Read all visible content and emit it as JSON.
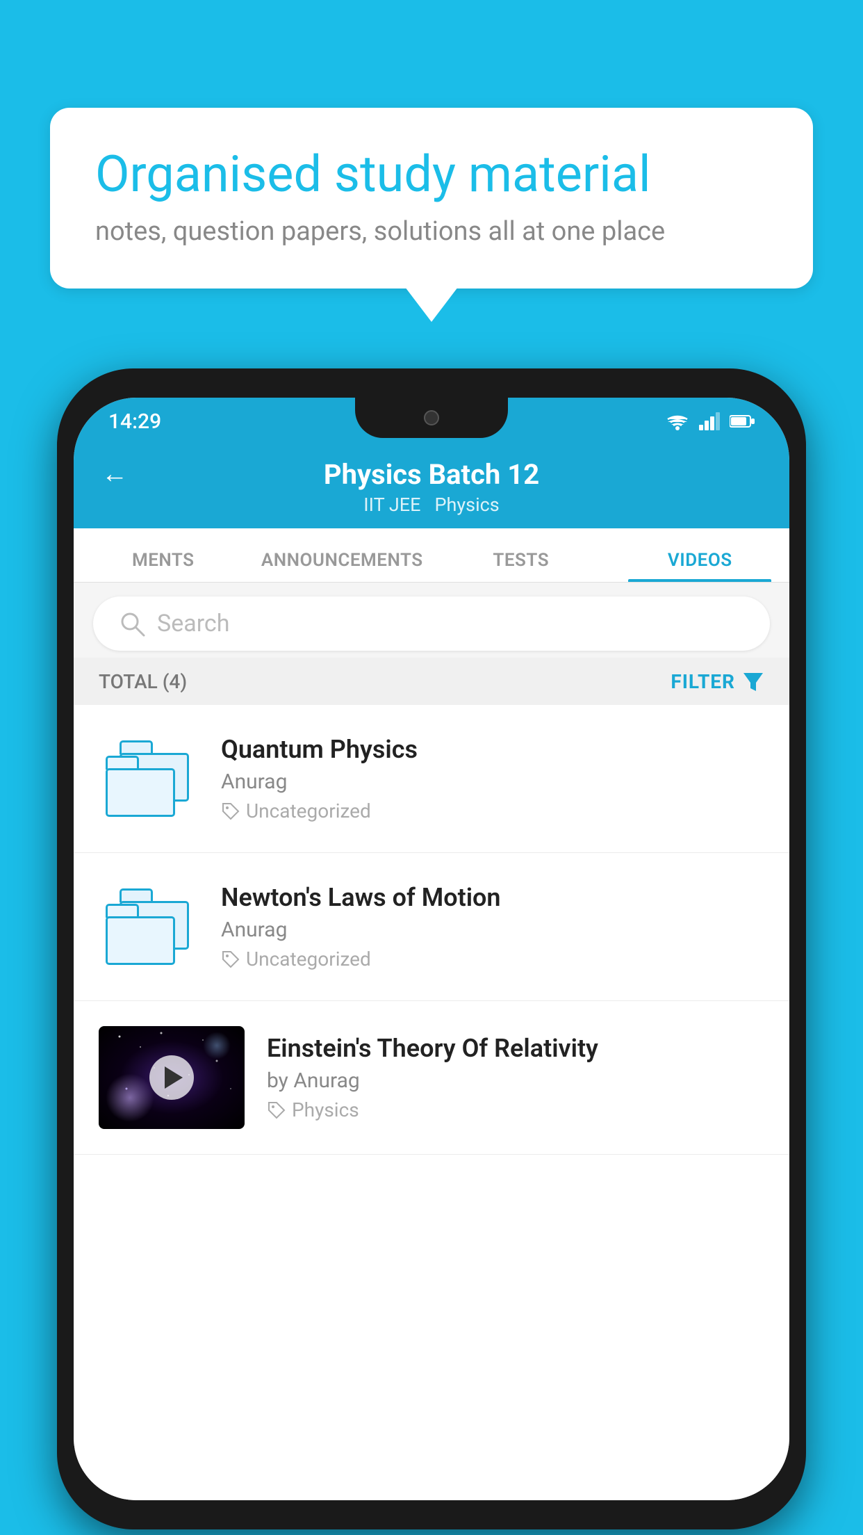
{
  "background_color": "#1bbde8",
  "speech_bubble": {
    "title": "Organised study material",
    "subtitle": "notes, question papers, solutions all at one place"
  },
  "status_bar": {
    "time": "14:29",
    "icons": [
      "wifi",
      "signal",
      "battery"
    ]
  },
  "app_header": {
    "back_label": "←",
    "title": "Physics Batch 12",
    "subtitle_left": "IIT JEE",
    "subtitle_right": "Physics"
  },
  "tabs": [
    {
      "label": "MENTS",
      "active": false
    },
    {
      "label": "ANNOUNCEMENTS",
      "active": false
    },
    {
      "label": "TESTS",
      "active": false
    },
    {
      "label": "VIDEOS",
      "active": true
    }
  ],
  "search": {
    "placeholder": "Search"
  },
  "filter_row": {
    "total_label": "TOTAL (4)",
    "filter_label": "FILTER"
  },
  "videos": [
    {
      "title": "Quantum Physics",
      "author": "Anurag",
      "tag": "Uncategorized",
      "has_thumbnail": false
    },
    {
      "title": "Newton's Laws of Motion",
      "author": "Anurag",
      "tag": "Uncategorized",
      "has_thumbnail": false
    },
    {
      "title": "Einstein's Theory Of Relativity",
      "author": "by Anurag",
      "tag": "Physics",
      "has_thumbnail": true
    }
  ]
}
